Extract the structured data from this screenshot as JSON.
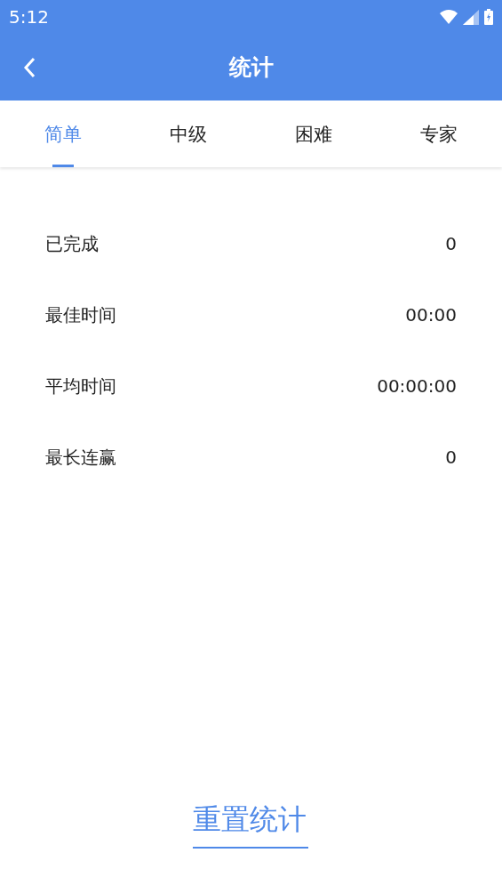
{
  "status_bar": {
    "time": "5:12"
  },
  "app_bar": {
    "title": "统计"
  },
  "tabs": [
    {
      "label": "简单",
      "selected": true
    },
    {
      "label": "中级",
      "selected": false
    },
    {
      "label": "困难",
      "selected": false
    },
    {
      "label": "专家",
      "selected": false
    }
  ],
  "stats": [
    {
      "label": "已完成",
      "value": "0"
    },
    {
      "label": "最佳时间",
      "value": "00:00"
    },
    {
      "label": "平均时间",
      "value": "00:00:00"
    },
    {
      "label": "最长连赢",
      "value": "0"
    }
  ],
  "reset_button": {
    "label": "重置统计"
  }
}
